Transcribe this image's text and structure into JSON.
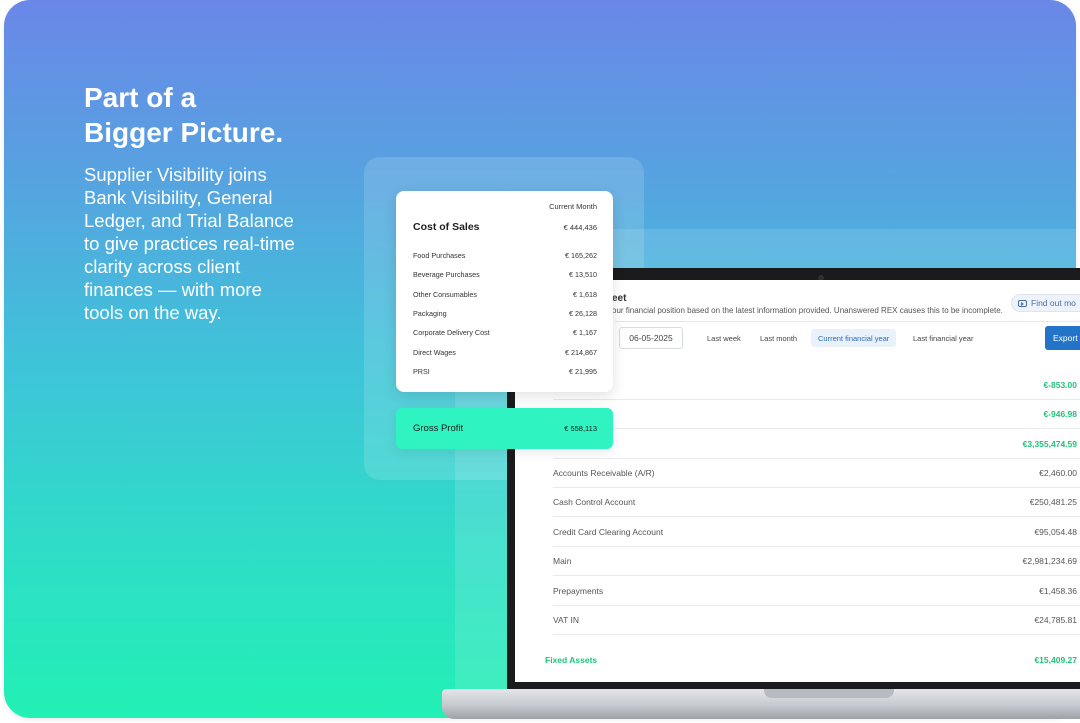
{
  "hero": {
    "headline_line1": "Part of a",
    "headline_line2": "Bigger Picture.",
    "body": "Supplier Visibility joins Bank Visibility, General Ledger, and Trial Balance to give practices real-time clarity across client finances — with more tools on the way."
  },
  "cost_card": {
    "column_header": "Current Month",
    "title": "Cost of Sales",
    "total": "€ 444,436",
    "items": [
      {
        "name": "Food Purchases",
        "value": "€ 165,262"
      },
      {
        "name": "Beverage Purchases",
        "value": "€ 13,510"
      },
      {
        "name": "Other Consumables",
        "value": "€ 1,618"
      },
      {
        "name": "Packaging",
        "value": "€ 26,128"
      },
      {
        "name": "Corporate Delivery Cost",
        "value": "€ 1,167"
      },
      {
        "name": "Direct Wages",
        "value": "€ 214,867"
      },
      {
        "name": "PRSI",
        "value": "€ 21,995"
      }
    ]
  },
  "gross_profit": {
    "label": "Gross Profit",
    "value": "€ 558,113"
  },
  "app": {
    "title": "eet",
    "description": "our financial position based on the latest information provided. Unanswered REX causes this to be incomplete.",
    "find_more": "Find out mo",
    "date_value": "06-05-2025",
    "periods": [
      "Last week",
      "Last month",
      "Current financial year",
      "Last financial year"
    ],
    "active_period": "Current financial year",
    "export_label": "Export",
    "summary_values": [
      "€-853.00",
      "€-946.98",
      "€3,355,474.59"
    ],
    "accounts": [
      {
        "name": "Accounts Receivable (A/R)",
        "value": "€2,460.00"
      },
      {
        "name": "Cash Control Account",
        "value": "€250,481.25"
      },
      {
        "name": "Credit Card Clearing Account",
        "value": "€95,054.48"
      },
      {
        "name": "Main",
        "value": "€2,981,234.69"
      },
      {
        "name": "Prepayments",
        "value": "€1,458.36"
      },
      {
        "name": "VAT IN",
        "value": "€24,785.81"
      }
    ],
    "fixed_assets": {
      "label": "Fixed Assets",
      "value": "€15,409.27"
    }
  },
  "colors": {
    "gradient_top": "#6a87e8",
    "gradient_bottom": "#22f0b4",
    "accent_green": "#22c27a",
    "gross_profit_bg": "#2ff3c0",
    "export_blue": "#2374c9"
  }
}
